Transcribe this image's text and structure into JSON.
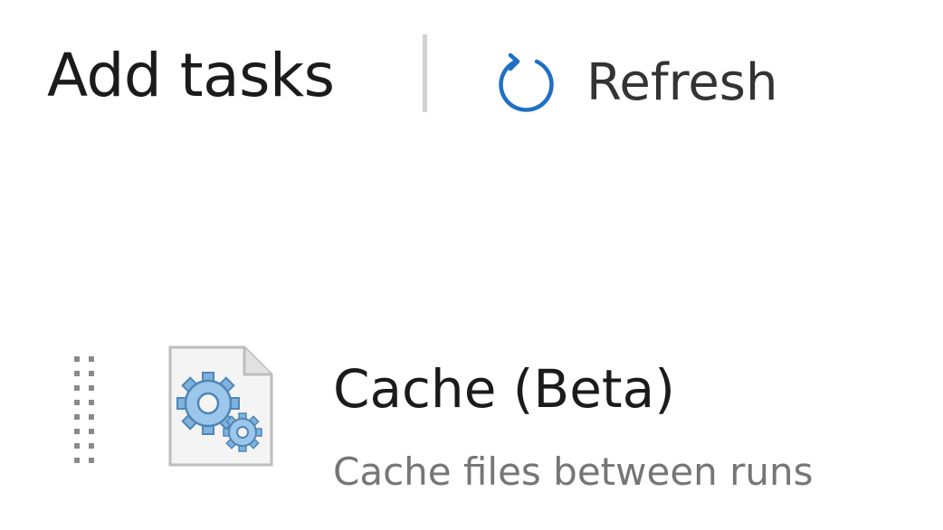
{
  "header": {
    "title": "Add tasks",
    "refresh_label": "Refresh"
  },
  "icons": {
    "refresh": "refresh-icon",
    "drag_handle": "drag-handle-icon",
    "task": "gear-document-icon"
  },
  "tasks": [
    {
      "title": "Cache (Beta)",
      "description": "Cache files between runs"
    }
  ],
  "colors": {
    "accent": "#0078d4",
    "text_primary": "#1b1b1b",
    "text_secondary": "#767676",
    "divider": "#d2d2d2"
  }
}
